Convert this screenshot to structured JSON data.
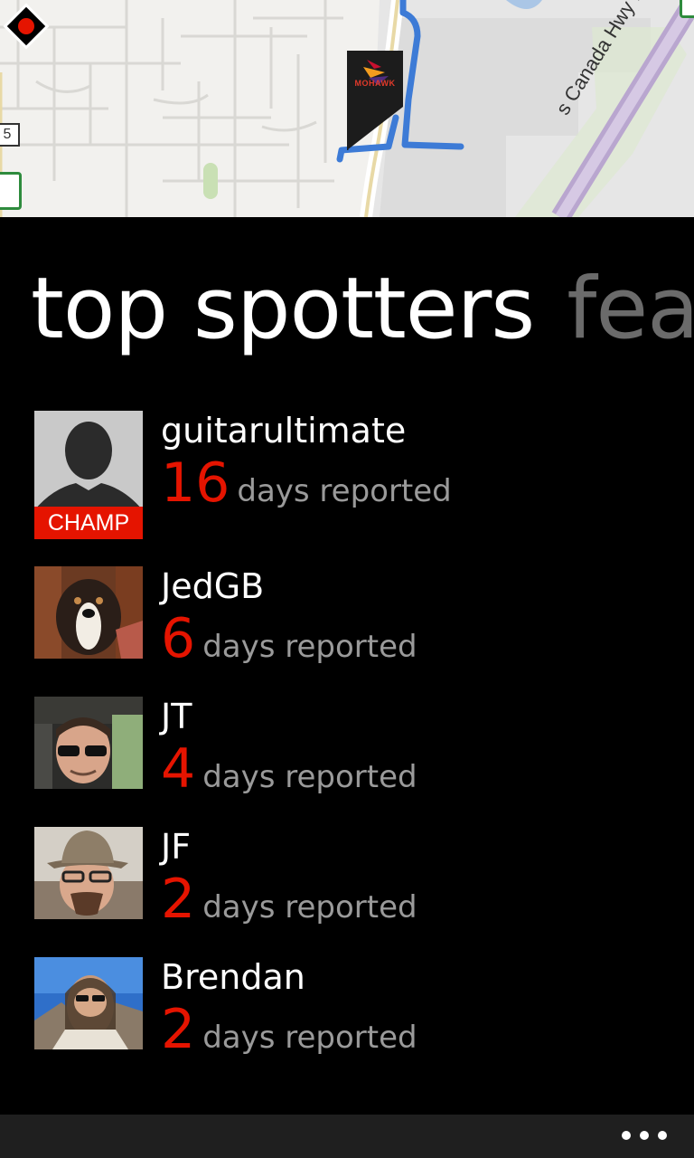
{
  "map": {
    "road_label": "s Canada Hwy E",
    "highway_shield": "5",
    "store_logo": "MOHAWK",
    "colors": {
      "route": "#3d7bd6",
      "marker": "#e51400",
      "highway": "#b9a6cf"
    }
  },
  "pivot": {
    "current": "top spotters",
    "next": "fea"
  },
  "spotters": [
    {
      "name": "guitarultimate",
      "count": "16",
      "unit": "days reported",
      "badge": "CHAMP",
      "avatar": "default-silhouette"
    },
    {
      "name": "JedGB",
      "count": "6",
      "unit": "days reported",
      "avatar": "dog-photo"
    },
    {
      "name": "JT",
      "count": "4",
      "unit": "days reported",
      "avatar": "man-sunglasses-photo"
    },
    {
      "name": "JF",
      "count": "2",
      "unit": "days reported",
      "avatar": "man-hat-photo"
    },
    {
      "name": "Brendan",
      "count": "2",
      "unit": "days reported",
      "avatar": "man-beard-photo"
    }
  ],
  "app_bar": {
    "more_icon": "ellipsis-icon"
  },
  "theme": {
    "accent": "#e51400",
    "background": "#000000",
    "subtle_text": "#9a9a9a"
  }
}
